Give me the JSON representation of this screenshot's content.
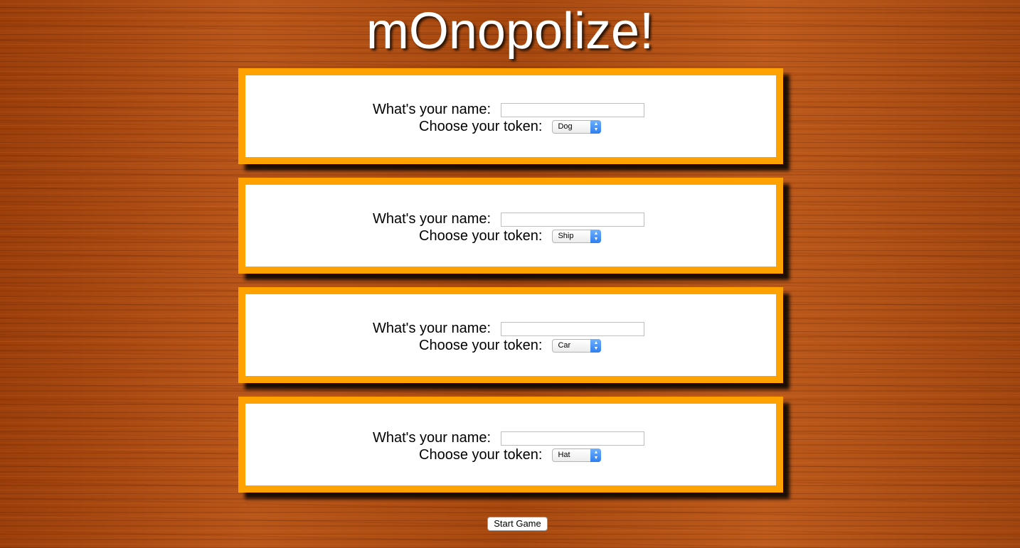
{
  "app": {
    "title": "mOnopolize!"
  },
  "players": [
    {
      "name_label": "What's your name:",
      "name_value": "",
      "token_label": "Choose your token:",
      "token_value": "Dog"
    },
    {
      "name_label": "What's your name:",
      "name_value": "",
      "token_label": "Choose your token:",
      "token_value": "Ship"
    },
    {
      "name_label": "What's your name:",
      "name_value": "",
      "token_label": "Choose your token:",
      "token_value": "Car"
    },
    {
      "name_label": "What's your name:",
      "name_value": "",
      "token_label": "Choose your token:",
      "token_value": "Hat"
    }
  ],
  "actions": {
    "start_label": "Start Game"
  },
  "colors": {
    "card_border": "#ffa200",
    "card_background": "#ffffff",
    "title_text": "#ffffff",
    "select_accent": "#2d7ef0"
  },
  "icons": {
    "select_indicator": "chevron-updown-icon"
  }
}
